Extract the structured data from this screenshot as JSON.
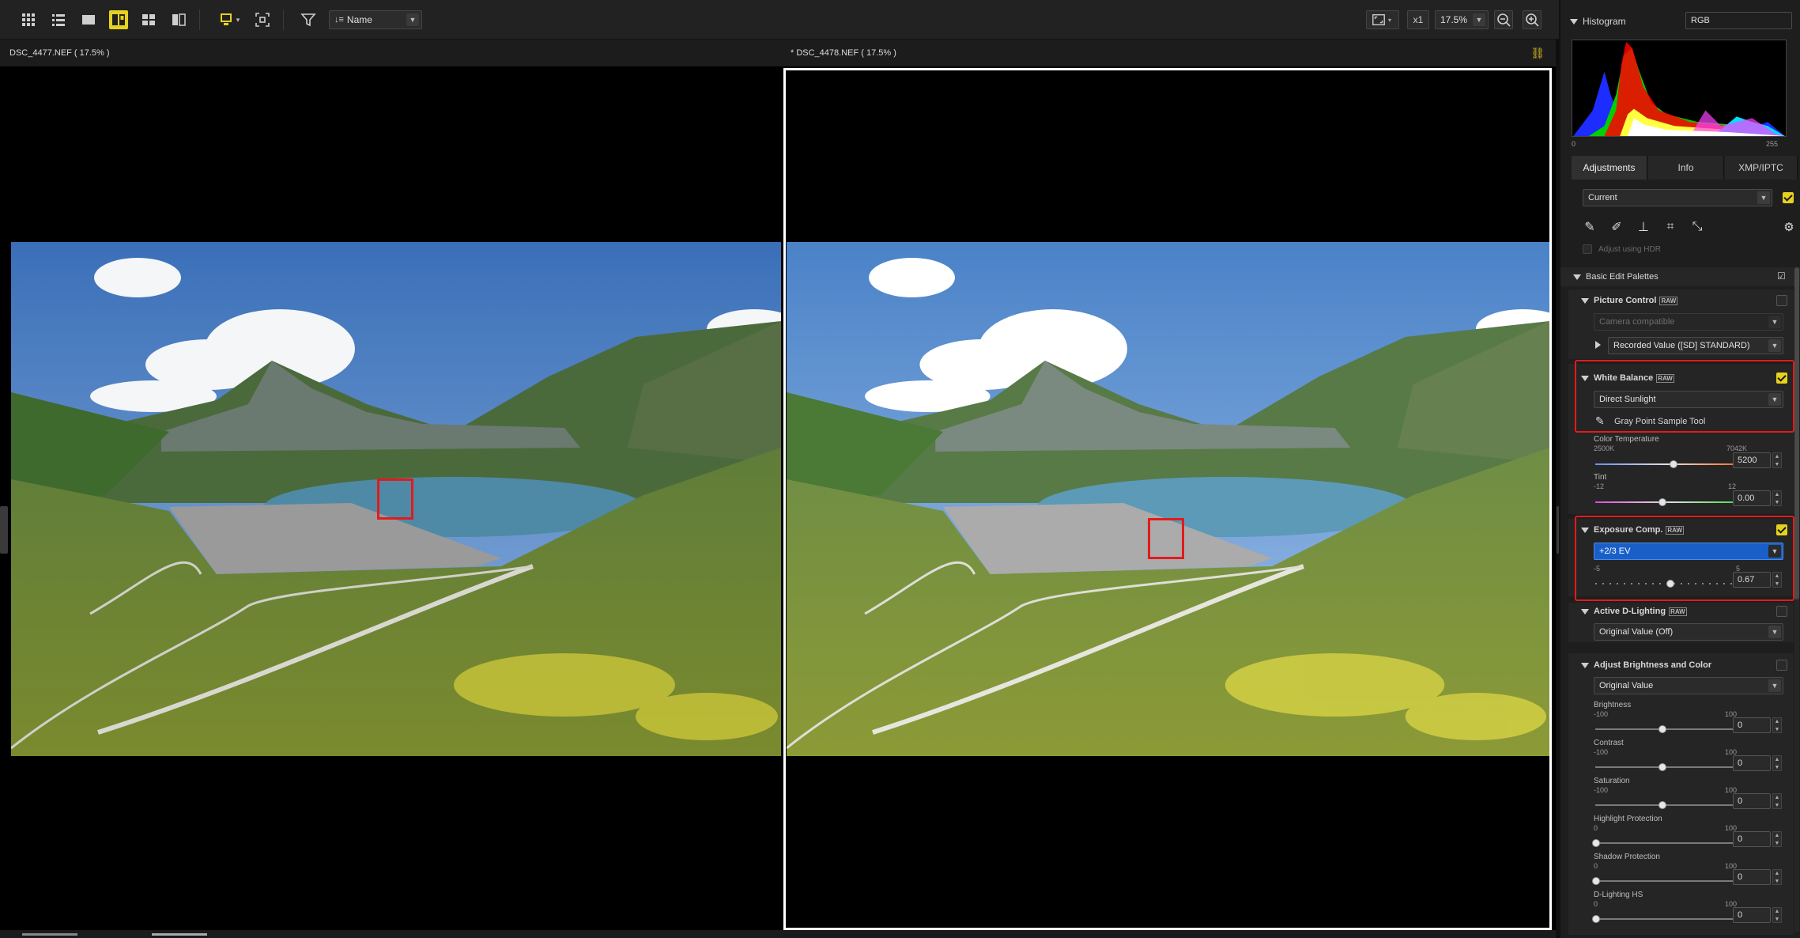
{
  "toolbar": {
    "sort_label": "Name",
    "zoom_ratio": "x1",
    "zoom_percent": "17.5%"
  },
  "viewers": {
    "left_title": "DSC_4477.NEF ( 17.5% )",
    "right_title": "* DSC_4478.NEF ( 17.5% )"
  },
  "histogram": {
    "title": "Histogram",
    "channel": "RGB",
    "min_label": "0",
    "max_label": "255"
  },
  "tabs": [
    "Adjustments",
    "Info",
    "XMP/IPTC"
  ],
  "adjustments": {
    "preset": "Current",
    "adjust_hdr": "Adjust using HDR",
    "basic_edit": "Basic Edit Palettes",
    "picture_control": {
      "title": "Picture Control",
      "mode": "Camera compatible",
      "value": "Recorded Value ([SD] STANDARD)"
    },
    "white_balance": {
      "title": "White Balance",
      "preset": "Direct Sunlight",
      "gray_point": "Gray Point Sample Tool",
      "temp_label": "Color Temperature",
      "temp_min": "2500K",
      "temp_max": "7042K",
      "temp_value": "5200",
      "tint_label": "Tint",
      "tint_min": "-12",
      "tint_max": "12",
      "tint_value": "0.00"
    },
    "exposure": {
      "title": "Exposure Comp.",
      "preset": "+2/3 EV",
      "min": "-5",
      "max": "5",
      "value": "0.67"
    },
    "adl": {
      "title": "Active D-Lighting",
      "value": "Original Value (Off)"
    },
    "brightness_color": {
      "title": "Adjust Brightness and Color",
      "preset": "Original Value",
      "sliders": [
        {
          "label": "Brightness",
          "min": "-100",
          "max": "100",
          "value": "0"
        },
        {
          "label": "Contrast",
          "min": "-100",
          "max": "100",
          "value": "0"
        },
        {
          "label": "Saturation",
          "min": "-100",
          "max": "100",
          "value": "0"
        },
        {
          "label": "Highlight Protection",
          "min": "0",
          "max": "100",
          "value": "0"
        },
        {
          "label": "Shadow Protection",
          "min": "0",
          "max": "100",
          "value": "0"
        },
        {
          "label": "D-Lighting HS",
          "min": "0",
          "max": "100",
          "value": "0"
        }
      ]
    }
  },
  "colors": {
    "accent_yellow": "#e6d21e",
    "highlight_red": "#e21b1b",
    "selection_blue": "#1a5fc8"
  }
}
